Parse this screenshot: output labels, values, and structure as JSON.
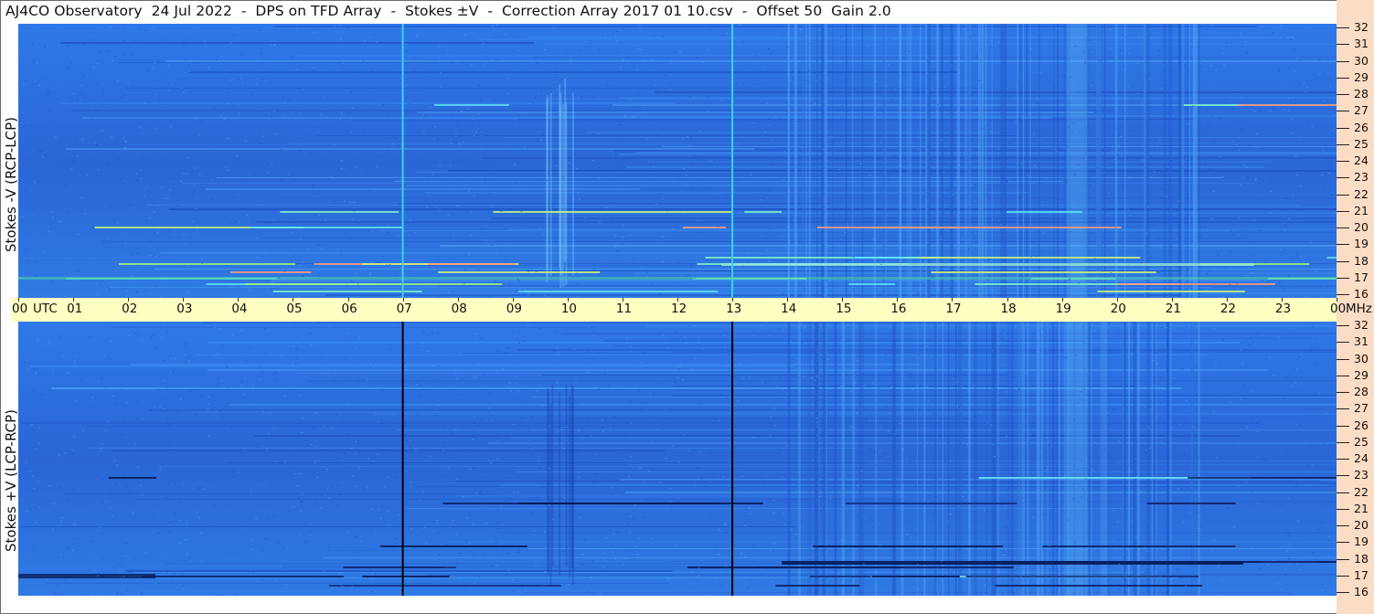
{
  "title": "AJ4CO Observatory  24 Jul 2022  -  DPS on TFD Array  -  Stokes ±V  -  Correction Array 2017 01 10.csv  -  Offset 50  Gain 2.0",
  "panels": {
    "top_label": "Stokes -V (RCP-LCP)",
    "bottom_label": "Stokes +V (LCP-RCP)"
  },
  "time_axis": {
    "labels": [
      "00",
      "01",
      "02",
      "03",
      "04",
      "05",
      "06",
      "07",
      "08",
      "09",
      "10",
      "11",
      "12",
      "13",
      "14",
      "15",
      "16",
      "17",
      "18",
      "19",
      "20",
      "21",
      "22",
      "23",
      "00"
    ],
    "unit_label": "UTC",
    "freq_unit_label": "MHz"
  },
  "freq_axis": {
    "labels": [
      "32",
      "31",
      "30",
      "29",
      "28",
      "27",
      "26",
      "25",
      "24",
      "23",
      "22",
      "21",
      "20",
      "19",
      "18",
      "17",
      "16"
    ]
  },
  "colors": {
    "background_blue": "#2c6ee0",
    "axis_bar": "#ffffc2",
    "right_strip": "#fbdcc5",
    "marker_top": "#3fd0e6",
    "marker_bottom": "#000000"
  },
  "chart_data": {
    "type": "heatmap",
    "title": "AJ4CO Observatory  24 Jul 2022  -  DPS on TFD Array  -  Stokes ±V  -  Correction Array 2017 01 10.csv  -  Offset 50  Gain 2.0",
    "x_axis": {
      "range_utc_hours": [
        0,
        24
      ],
      "ticks": [
        "00",
        "01",
        "02",
        "03",
        "04",
        "05",
        "06",
        "07",
        "08",
        "09",
        "10",
        "11",
        "12",
        "13",
        "14",
        "15",
        "16",
        "17",
        "18",
        "19",
        "20",
        "21",
        "22",
        "23",
        "00"
      ]
    },
    "y_axis": {
      "unit": "MHz",
      "range": [
        16,
        32
      ]
    },
    "series": [
      {
        "name": "Stokes -V (RCP-LCP)"
      },
      {
        "name": "Stokes +V (LCP-RCP)"
      }
    ],
    "marker_hours_utc": [
      7,
      13
    ]
  }
}
